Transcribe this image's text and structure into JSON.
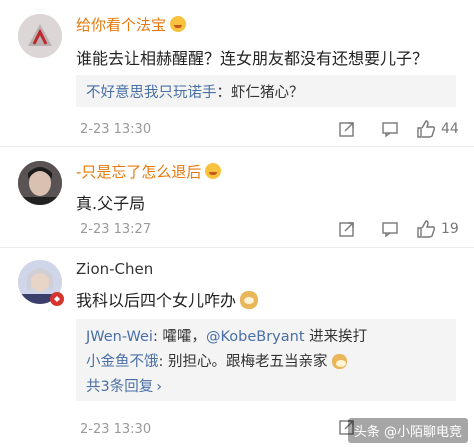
{
  "comments": [
    {
      "username": "给你看个法宝",
      "text": "谁能去让相赫醒醒？连女朋友都没有还想要儿子？",
      "replies": [
        {
          "user": "不好意思我只玩诺手",
          "sep": "：",
          "text": "虾仁猪心？"
        }
      ],
      "time": "2-23 13:30",
      "likes": "44"
    },
    {
      "username": "-只是忘了怎么退后",
      "text": "真.父子局",
      "time": "2-23 13:27",
      "likes": "19"
    },
    {
      "username": "Zion-Chen",
      "text": "我科以后四个女儿咋办",
      "replies": [
        {
          "user": "JWen-Wei",
          "sep": ": ",
          "text_a": "嚯嚯，",
          "mention": "@KobeBryant",
          "text_b": " 进来挨打"
        },
        {
          "user": "小金鱼不饿",
          "sep": ": ",
          "text": "别担心。跟梅老五当亲家"
        }
      ],
      "more_replies": "共3条回复",
      "more_arrow": "›",
      "time": "2-23 13:30"
    }
  ],
  "watermark": "头条 @小陌聊电竞",
  "colors": {
    "username_highlight": "#e8790c",
    "link": "#4a6fa5",
    "reply_bg": "#f4f4f4"
  }
}
